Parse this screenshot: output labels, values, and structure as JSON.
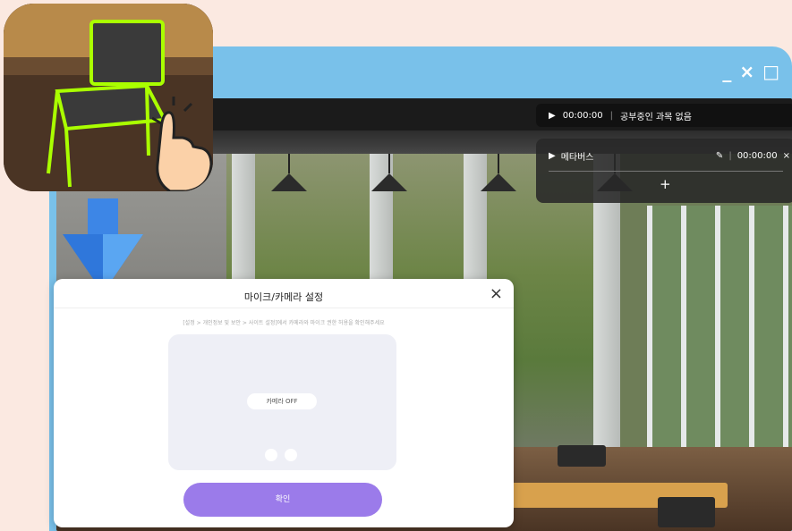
{
  "window": {
    "controls": {
      "minimize": "_",
      "close": "×",
      "maximize": "□"
    }
  },
  "hud": {
    "timer1": "00:00:00",
    "study_status": "공부중인 과목 없음",
    "subject": "메타버스",
    "timer2": "00:00:00",
    "add": "+",
    "close": "×"
  },
  "dialog": {
    "title": "마이크/카메라 설정",
    "close": "×",
    "hint": "[설정 > 개인정보 및 보안 > 사이트 설정]에서 카메라와 마이크 권한 허용을 확인해주세요",
    "camera_state": "카메라 OFF",
    "confirm": "확인"
  },
  "colors": {
    "window_frame": "#79c1ea",
    "confirm_button": "#9b7bea",
    "background": "#fbe9e1",
    "highlight": "#aaff00"
  },
  "icons": [
    "chair-zoom-icon",
    "hand-pointer-icon",
    "down-arrow-icon",
    "play-icon",
    "pen-icon",
    "camera-icon",
    "mic-icon"
  ]
}
